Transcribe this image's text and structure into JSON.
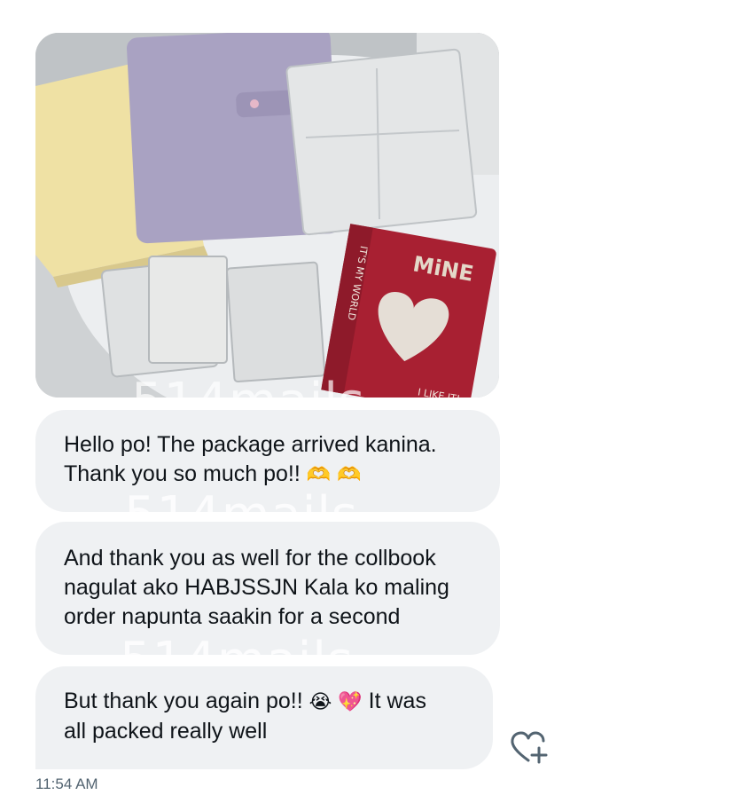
{
  "message_image": {
    "alt": "",
    "cover_text_1": "MiNE",
    "cover_text_2": "I LIKE IT!",
    "spine_text": "IT'S MY WORLD"
  },
  "messages": [
    {
      "line1": "Hello po! The package arrived kanina.",
      "line2": "Thank you so much po!!",
      "emoji": "🫶 🫶"
    },
    {
      "line1": "And thank you as well for the collbook",
      "line2": "nagulat ako HABJSSJN Kala ko maling",
      "line3": "order napunta saakin for a second"
    },
    {
      "line1_pre": "But thank you again po!!",
      "emoji": "😭 💖",
      "line1_post": "It was",
      "line2": "all packed really well"
    }
  ],
  "watermark": "514mails",
  "timestamp": "11:54 AM",
  "icons": {
    "react": "heart-plus-icon"
  },
  "colors": {
    "bubble": "#eff1f3",
    "text": "#0f1419",
    "meta": "#536471"
  }
}
